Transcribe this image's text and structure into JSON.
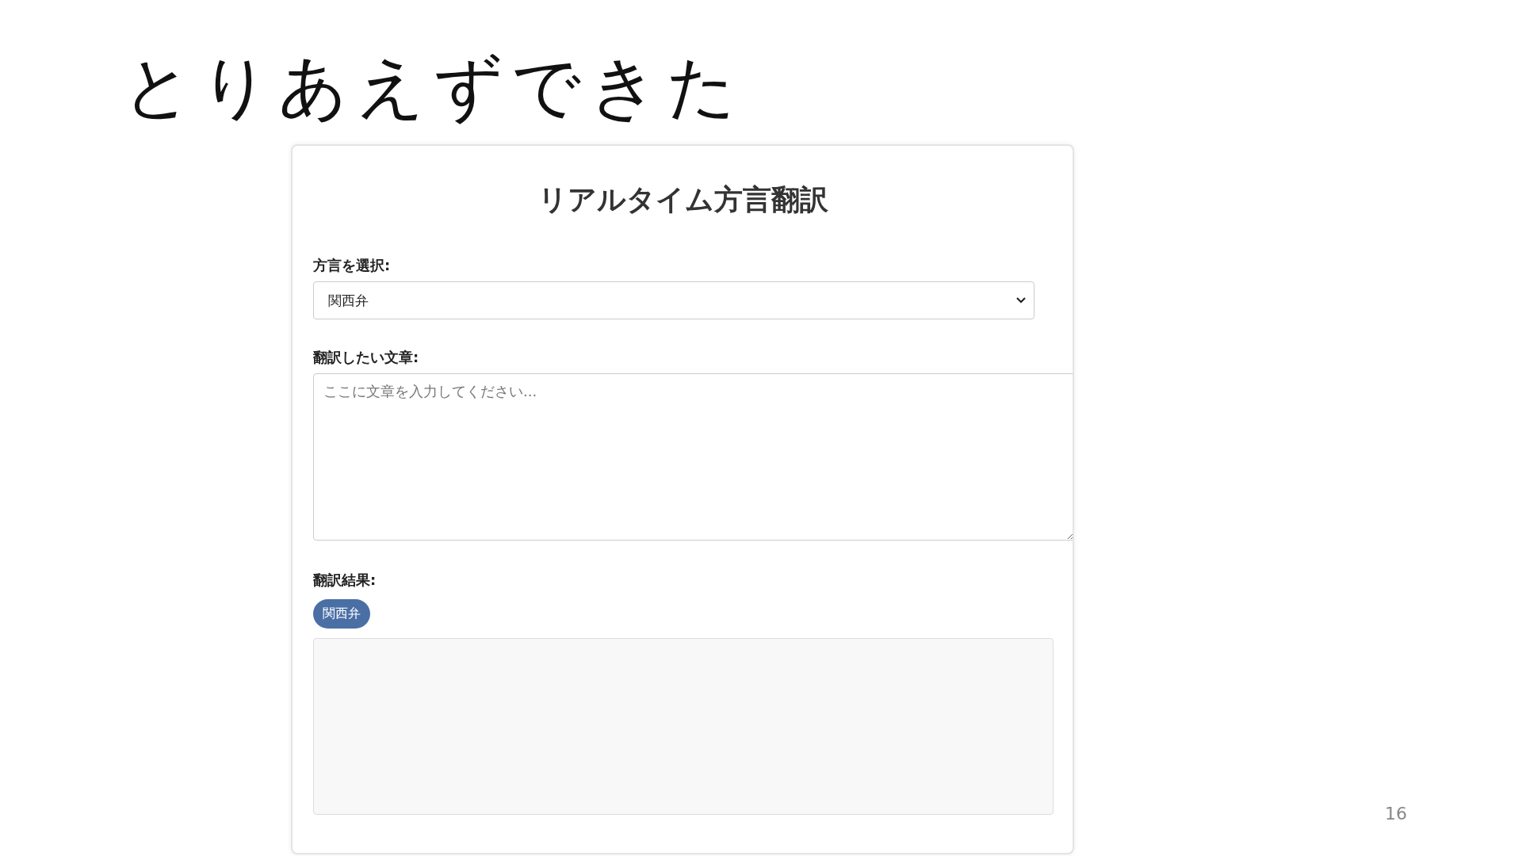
{
  "slide_title": "とりあえずできた",
  "app": {
    "title": "リアルタイム方言翻訳",
    "dialect_label": "方言を選択:",
    "dialect_select": {
      "value": "関西弁"
    },
    "input_label": "翻訳したい文章:",
    "input": {
      "placeholder": "ここに文章を入力してください..."
    },
    "result_label": "翻訳結果:",
    "result_badge": "関西弁"
  },
  "page_number": "16"
}
